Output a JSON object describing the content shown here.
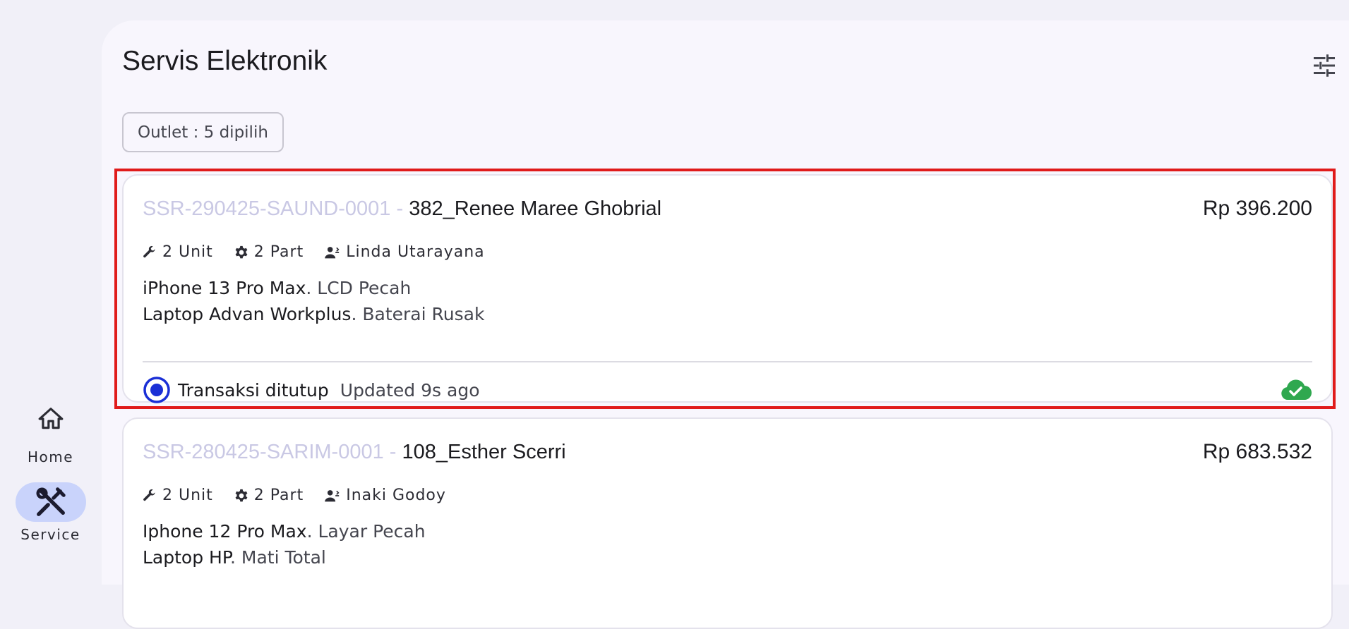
{
  "page": {
    "title": "Servis Elektronik",
    "filter_chip": "Outlet : 5 dipilih",
    "filter_icon": "tune-icon"
  },
  "nav_rail": {
    "items": [
      {
        "label": "Home",
        "icon": "home-icon",
        "selected": false
      },
      {
        "label": "Service",
        "icon": "tools-icon",
        "selected": true
      }
    ]
  },
  "colors": {
    "accent": "#1a2fd6",
    "selected_rail_bg": "#c9d3fb",
    "sync_ok": "#2fa84f",
    "highlight_border": "#e01b1b"
  },
  "orders": [
    {
      "code": "SSR-290425-SAUND-0001",
      "separator": " - ",
      "customer": "382_Renee Maree Ghobrial",
      "price": "Rp 396.200",
      "units": "2 Unit",
      "parts": "2 Part",
      "technician": "Linda Utarayana",
      "items": [
        {
          "device": "iPhone 13 Pro Max",
          "issue": ". LCD Pecah"
        },
        {
          "device": "Laptop Advan Workplus",
          "issue": ". Baterai Rusak"
        }
      ],
      "status": "Transaksi ditutup",
      "updated": "Updated 9s ago",
      "sync_icon": "cloud-check-icon"
    },
    {
      "code": "SSR-280425-SARIM-0001",
      "separator": " - ",
      "customer": "108_Esther Scerri",
      "price": "Rp 683.532",
      "units": "2 Unit",
      "parts": "2 Part",
      "technician": "Inaki Godoy",
      "items": [
        {
          "device": "Iphone 12 Pro Max",
          "issue": ". Layar Pecah"
        },
        {
          "device": "Laptop HP",
          "issue": ". Mati Total"
        }
      ]
    }
  ]
}
